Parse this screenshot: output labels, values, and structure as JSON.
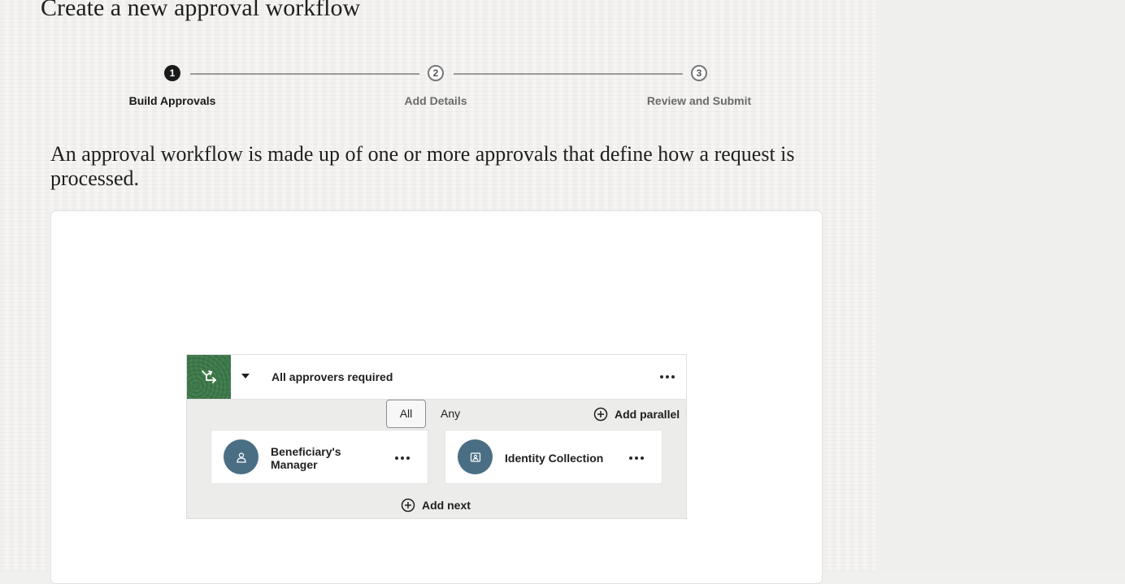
{
  "page": {
    "title": "Create a new approval workflow",
    "intro": "An approval workflow is made up of one or more approvals that define how a request is processed."
  },
  "stepper": {
    "steps": [
      {
        "number": "1",
        "label": "Build Approvals",
        "state": "active"
      },
      {
        "number": "2",
        "label": "Add Details",
        "state": "upcoming"
      },
      {
        "number": "3",
        "label": "Review and Submit",
        "state": "upcoming"
      }
    ]
  },
  "approval_group": {
    "icon": "workflow-branch-icon",
    "title": "All approvers required",
    "mode_options": [
      "All",
      "Any"
    ],
    "selected_mode": "All",
    "add_parallel_label": "Add parallel",
    "add_next_label": "Add next",
    "approvers": [
      {
        "label": "Beneficiary's Manager",
        "icon": "person-icon"
      },
      {
        "label": "Identity Collection",
        "icon": "id-card-icon"
      }
    ]
  },
  "colors": {
    "tile_green": "#3f7a4c",
    "avatar_blue": "#4a6f84",
    "active_step": "#1a1a1a"
  }
}
